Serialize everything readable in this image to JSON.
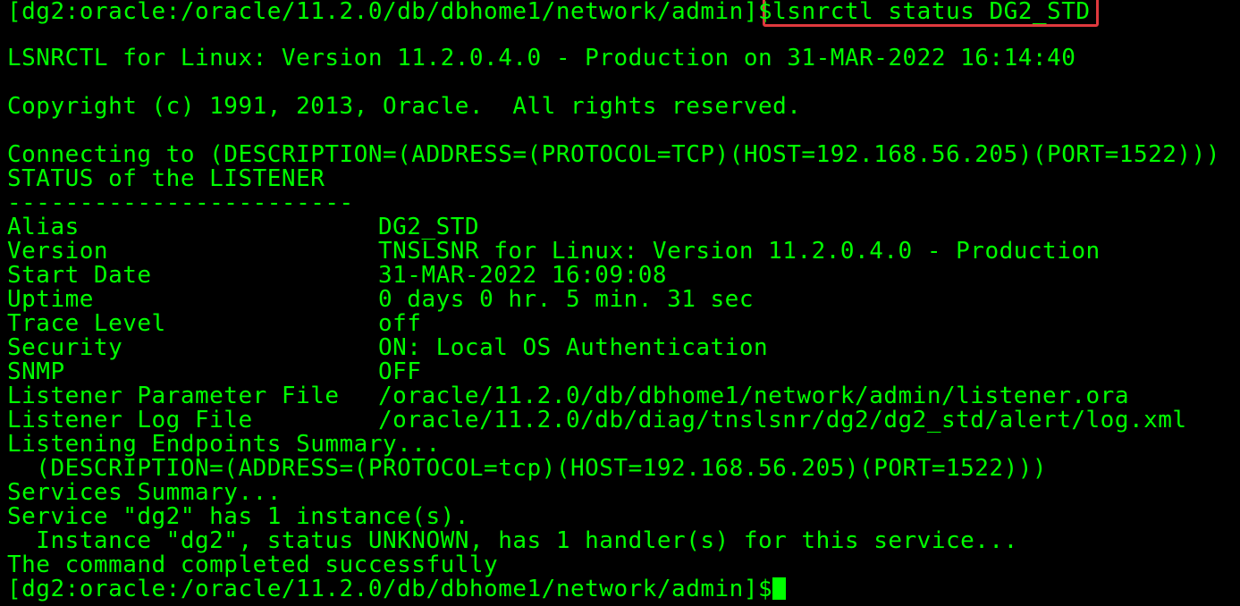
{
  "prompt": "[dg2:oracle:/oracle/11.2.0/db/dbhome1/network/admin]$",
  "command": "lsnrctl status DG2_STD",
  "banner": "LSNRCTL for Linux: Version 11.2.0.4.0 - Production on 31-MAR-2022 16:14:40",
  "copyright": "Copyright (c) 1991, 2013, Oracle.  All rights reserved.",
  "connecting": "Connecting to (DESCRIPTION=(ADDRESS=(PROTOCOL=TCP)(HOST=192.168.56.205)(PORT=1522)))",
  "status_header": "STATUS of the LISTENER",
  "separator": "------------------------",
  "fields": [
    {
      "key": "Alias",
      "value": "DG2_STD"
    },
    {
      "key": "Version",
      "value": "TNSLSNR for Linux: Version 11.2.0.4.0 - Production"
    },
    {
      "key": "Start Date",
      "value": "31-MAR-2022 16:09:08"
    },
    {
      "key": "Uptime",
      "value": "0 days 0 hr. 5 min. 31 sec"
    },
    {
      "key": "Trace Level",
      "value": "off"
    },
    {
      "key": "Security",
      "value": "ON: Local OS Authentication"
    },
    {
      "key": "SNMP",
      "value": "OFF"
    },
    {
      "key": "Listener Parameter File",
      "value": "/oracle/11.2.0/db/dbhome1/network/admin/listener.ora"
    },
    {
      "key": "Listener Log File",
      "value": "/oracle/11.2.0/db/diag/tnslsnr/dg2/dg2_std/alert/log.xml"
    }
  ],
  "endpoints_header": "Listening Endpoints Summary...",
  "endpoint": "  (DESCRIPTION=(ADDRESS=(PROTOCOL=tcp)(HOST=192.168.56.205)(PORT=1522)))",
  "services_header": "Services Summary...",
  "service_line": "Service \"dg2\" has 1 instance(s).",
  "instance_line": "  Instance \"dg2\", status UNKNOWN, has 1 handler(s) for this service...",
  "completed": "The command completed successfully",
  "colors": {
    "background": "#000000",
    "text": "#00ff00",
    "highlight_border": "#e0393e"
  }
}
